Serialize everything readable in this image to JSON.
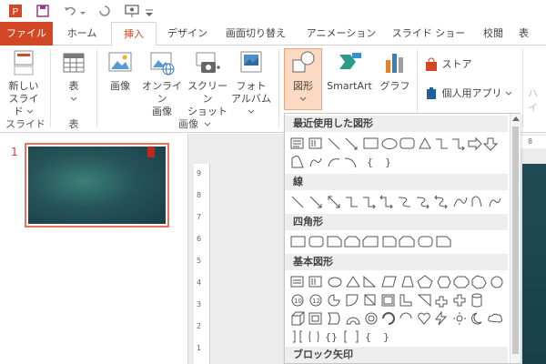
{
  "tabs": [
    "ファイル",
    "ホーム",
    "挿入",
    "デザイン",
    "画面切り替え",
    "アニメーション",
    "スライド ショー",
    "校閲",
    "表"
  ],
  "ribbon": {
    "new_slide": "新しい\nスライド",
    "new_slide_l1": "新しい",
    "new_slide_l2": "スライド",
    "table": "表",
    "image": "画像",
    "online_image_l1": "オンライン",
    "online_image_l2": "画像",
    "screenshot_l1": "スクリーン",
    "screenshot_l2": "ショット",
    "album_l1": "フォト",
    "album_l2": "アルバム",
    "shapes": "図形",
    "smartart": "SmartArt",
    "graph": "グラフ",
    "store": "ストア",
    "my_apps": "個人用アプリ",
    "hy": "ハイ",
    "group_slide": "スライド",
    "group_table": "表",
    "group_image": "画像"
  },
  "slides": {
    "number": "1"
  },
  "ruler": {
    "marks": [
      "9",
      "8",
      "7",
      "6",
      "5",
      "4",
      "3",
      "2",
      "1"
    ],
    "top": "8"
  },
  "dropdown": {
    "sections": [
      "最近使用した図形",
      "線",
      "四角形",
      "基本図形",
      "ブロック矢印"
    ]
  },
  "colors": {
    "accent": "#d24726",
    "file_tab": "#d24726",
    "slide_bg": "#25545a"
  }
}
